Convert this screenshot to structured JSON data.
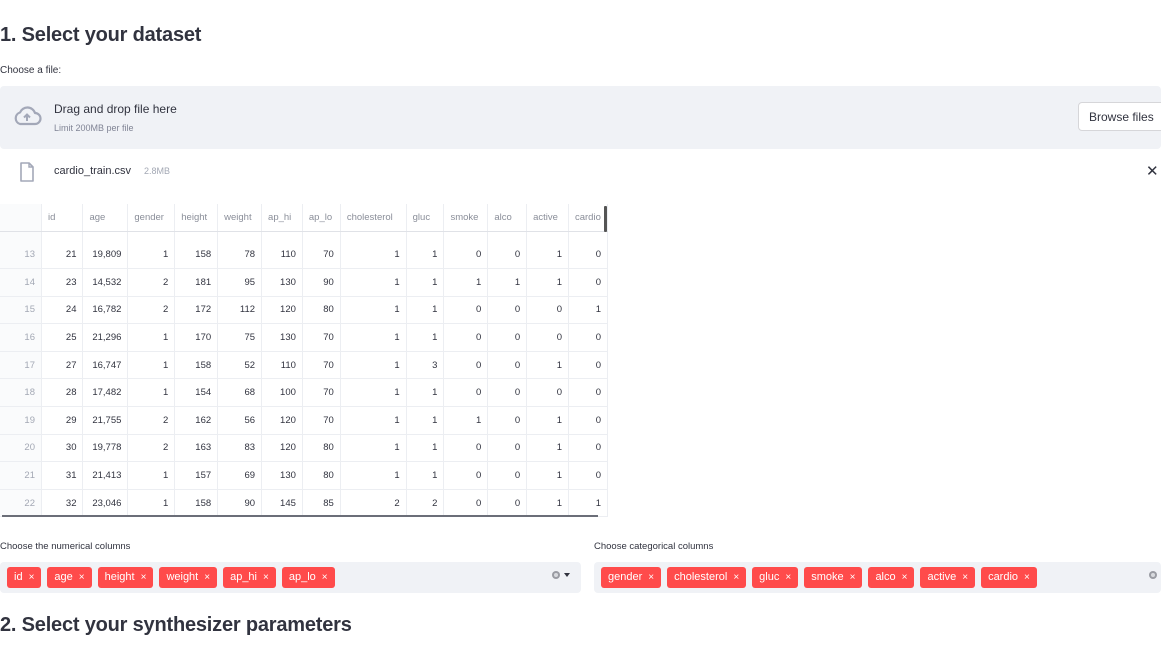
{
  "section1": {
    "title": "1. Select your dataset"
  },
  "uploader": {
    "label": "Choose a file:",
    "drop_title": "Drag and drop file here",
    "drop_limit": "Limit 200MB per file",
    "browse_label": "Browse files",
    "close_symbol": "✕"
  },
  "file": {
    "name": "cardio_train.csv",
    "size": "2.8MB"
  },
  "table": {
    "columns": [
      "",
      "id",
      "age",
      "gender",
      "height",
      "weight",
      "ap_hi",
      "ap_lo",
      "cholesterol",
      "gluc",
      "smoke",
      "alco",
      "active",
      "cardio"
    ],
    "rows": [
      [
        "13",
        "21",
        "19,809",
        "1",
        "158",
        "78",
        "110",
        "70",
        "1",
        "1",
        "0",
        "0",
        "1",
        "0"
      ],
      [
        "14",
        "23",
        "14,532",
        "2",
        "181",
        "95",
        "130",
        "90",
        "1",
        "1",
        "1",
        "1",
        "1",
        "0"
      ],
      [
        "15",
        "24",
        "16,782",
        "2",
        "172",
        "112",
        "120",
        "80",
        "1",
        "1",
        "0",
        "0",
        "0",
        "1"
      ],
      [
        "16",
        "25",
        "21,296",
        "1",
        "170",
        "75",
        "130",
        "70",
        "1",
        "1",
        "0",
        "0",
        "0",
        "0"
      ],
      [
        "17",
        "27",
        "16,747",
        "1",
        "158",
        "52",
        "110",
        "70",
        "1",
        "3",
        "0",
        "0",
        "1",
        "0"
      ],
      [
        "18",
        "28",
        "17,482",
        "1",
        "154",
        "68",
        "100",
        "70",
        "1",
        "1",
        "0",
        "0",
        "0",
        "0"
      ],
      [
        "19",
        "29",
        "21,755",
        "2",
        "162",
        "56",
        "120",
        "70",
        "1",
        "1",
        "1",
        "0",
        "1",
        "0"
      ],
      [
        "20",
        "30",
        "19,778",
        "2",
        "163",
        "83",
        "120",
        "80",
        "1",
        "1",
        "0",
        "0",
        "1",
        "0"
      ],
      [
        "21",
        "31",
        "21,413",
        "1",
        "157",
        "69",
        "130",
        "80",
        "1",
        "1",
        "0",
        "0",
        "1",
        "0"
      ],
      [
        "22",
        "32",
        "23,046",
        "1",
        "158",
        "90",
        "145",
        "85",
        "2",
        "2",
        "0",
        "0",
        "1",
        "1"
      ]
    ]
  },
  "numerical": {
    "label": "Choose the numerical columns",
    "selected": [
      "id",
      "age",
      "height",
      "weight",
      "ap_hi",
      "ap_lo"
    ]
  },
  "categorical": {
    "label": "Choose categorical columns",
    "selected": [
      "gender",
      "cholesterol",
      "gluc",
      "smoke",
      "alco",
      "active",
      "cardio"
    ]
  },
  "chip_remove_symbol": "×",
  "section2": {
    "title": "2. Select your synthesizer parameters"
  },
  "colors": {
    "accent": "#ff4b4b",
    "panel": "#f0f2f6",
    "text": "#31333f"
  }
}
